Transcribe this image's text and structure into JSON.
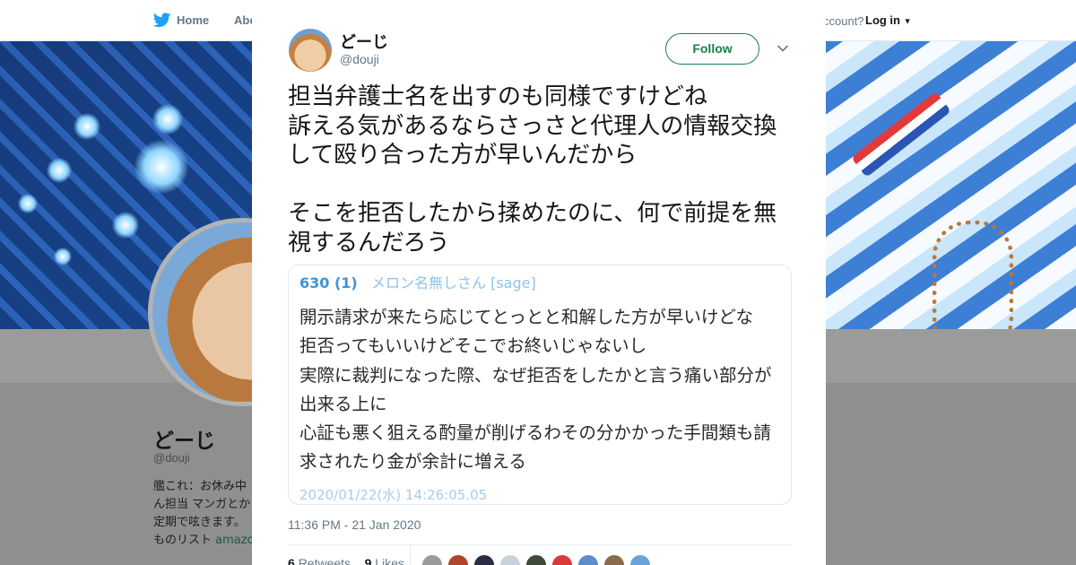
{
  "topbar": {
    "home_label": "Home",
    "about_label": "Abo",
    "account_question": "ccount?",
    "login_label": "Log in"
  },
  "profile": {
    "name": "どーじ",
    "handle": "@douji",
    "bio_lines": [
      "艦これ：お休み中",
      "ん担当 マンガとか",
      "定期で呟きます。",
      "ものリスト "
    ],
    "bio_link": "amazo"
  },
  "tweet": {
    "display_name": "どーじ",
    "handle": "@douji",
    "follow_label": "Follow",
    "text": "担当弁護士名を出すのも同様ですけどね\n訴える気があるならさっさと代理人の情報交換して殴り合った方が早いんだから\n\nそこを拒否したから揉めたのに、何で前提を無視するんだろう",
    "timestamp": "11:36 PM - 21 Jan 2020",
    "retweets_count": "6",
    "retweets_label": "Retweets",
    "likes_count": "9",
    "likes_label": "Likes"
  },
  "media": {
    "post_number": "630 (1)",
    "poster": "メロン名無しさん [sage]",
    "body": "開示請求が来たら応じてとっとと和解した方が早いけどな\n拒否ってもいいけどそこでお終いじゃないし\n実際に裁判になった際、なぜ拒否をしたかと言う痛い部分が出来る上に\n心証も悪く狙える酌量が削げるわその分かかった手間類も請求されたり金が余計に増える",
    "date": "2020/01/22(水) 14:26:05.05"
  },
  "likers": [
    {
      "color": "#9a9a9a"
    },
    {
      "color": "#b0452c"
    },
    {
      "color": "#2c2c44"
    },
    {
      "color": "#c9d2dc"
    },
    {
      "color": "#3d4a3a"
    },
    {
      "color": "#d93a3a"
    },
    {
      "color": "#5a8fc9"
    },
    {
      "color": "#8a6a4a"
    },
    {
      "color": "#6aa3d8"
    }
  ],
  "colors": {
    "accent_green": "#1b7f4a",
    "text_dark": "#14171a",
    "text_muted": "#657786",
    "overlay": "#8f8f8f"
  },
  "icons": [
    "twitter-bird-icon",
    "close-icon",
    "chevron-down-icon"
  ]
}
